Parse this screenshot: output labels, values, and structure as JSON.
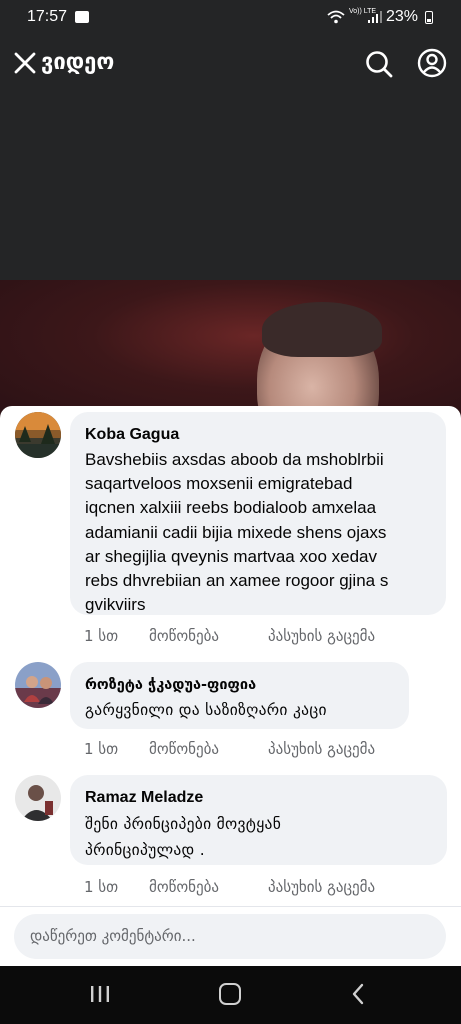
{
  "status_bar": {
    "time": "17:57",
    "network": "Vo)) LTE",
    "battery": "23%",
    "icons": [
      "gallery-icon",
      "wifi-icon",
      "signal-icon",
      "battery-icon"
    ]
  },
  "header": {
    "title": "ვიდეო",
    "icons": [
      "close-icon",
      "search-icon",
      "profile-icon"
    ],
    "background": "#242526"
  },
  "comments": [
    {
      "author": "Koba Gagua",
      "text": "Bavshebiis axsdas aboob da mshoblrbii\nsaqartveloos moxsenii emigratebad\niqcnen xalxiii reebs bodialoob amxelaa\nadamianii cadii bijia mixede shens ojaxs\nar shegijlia qveynis martvaa xoo xedav\nrebs dhvrebiian an xamee rogoor gjina s\ngvikviirs",
      "time": "1 სთ",
      "like": "მოწონება",
      "reply": "პასუხის გაცემა"
    },
    {
      "author": "როზეტა ჭკადუა-ფიფია",
      "text": "გარყვნილი და საზიზღარი კაცი",
      "time": "1 სთ",
      "like": "მოწონება",
      "reply": "პასუხის გაცემა"
    },
    {
      "author": "Ramaz Meladze",
      "text": "შენი პრინციპები მოვტყან\nპრინციპულად .",
      "time": "1 სთ",
      "like": "მოწონება",
      "reply": "პასუხის გაცემა"
    }
  ],
  "composer": {
    "placeholder": "დაწერეთ კომენტარი..."
  },
  "nav_bar": {
    "icons": [
      "recents-icon",
      "home-icon",
      "back-icon"
    ]
  },
  "colors": {
    "bubble": "#f0f2f5",
    "secondary_text": "#65676b",
    "primary_text": "#050505"
  }
}
